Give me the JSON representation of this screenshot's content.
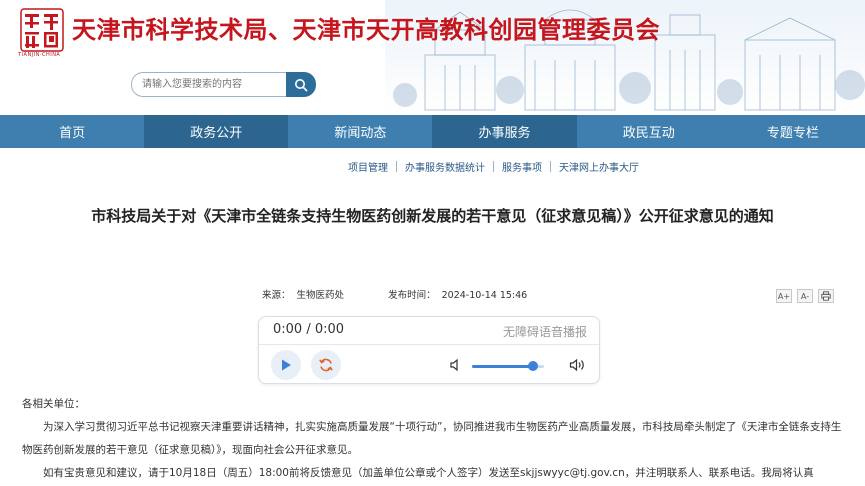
{
  "header": {
    "site_title": "天津市科学技术局、天津市天开高教科创园管理委员会",
    "logo_subtext": "TIANJIN·CHINA",
    "search_placeholder": "请输入您要搜索的内容"
  },
  "nav": {
    "items": [
      {
        "label": "首页",
        "active": false
      },
      {
        "label": "政务公开",
        "active": true
      },
      {
        "label": "新闻动态",
        "active": false
      },
      {
        "label": "办事服务",
        "active": true
      },
      {
        "label": "政民互动",
        "active": false
      },
      {
        "label": "专题专栏",
        "active": false
      }
    ]
  },
  "subnav": {
    "items": [
      "项目管理",
      "办事服务数据统计",
      "服务事项",
      "天津网上办事大厅"
    ]
  },
  "article": {
    "title": "市科技局关于对《天津市全链条支持生物医药创新发展的若干意见（征求意见稿）》公开征求意见的通知",
    "source_label": "来源：",
    "source_value": "生物医药处",
    "date_label": "发布时间：",
    "date_value": "2024-10-14 15:46"
  },
  "player": {
    "time": "0:00 / 0:00",
    "label": "无障碍语音播报",
    "volume": 0.85
  },
  "tools": {
    "font_increase": "A+",
    "font_decrease": "A-",
    "print": "print-icon"
  },
  "body": {
    "salutation": "各相关单位：",
    "para1": "为深入学习贯彻习近平总书记视察天津重要讲话精神，扎实实施高质量发展“十项行动”，协同推进我市生物医药产业高质量发展，市科技局牵头制定了《天津市全链条支持生物医药创新发展的若干意见（征求意见稿）》，现面向社会公开征求意见。",
    "para2": "如有宝贵意见和建议，请于10月18日（周五）18:00前将反馈意见（加盖单位公章或个人签字）发送至skjjswyyc@tj.gov.cn，并注明联系人、联系电话。我局将认真"
  },
  "colors": {
    "brand_red": "#c4161c",
    "nav_blue": "#3e7fb0",
    "nav_active": "#2c6690",
    "accent_blue": "#3e7fd8"
  }
}
